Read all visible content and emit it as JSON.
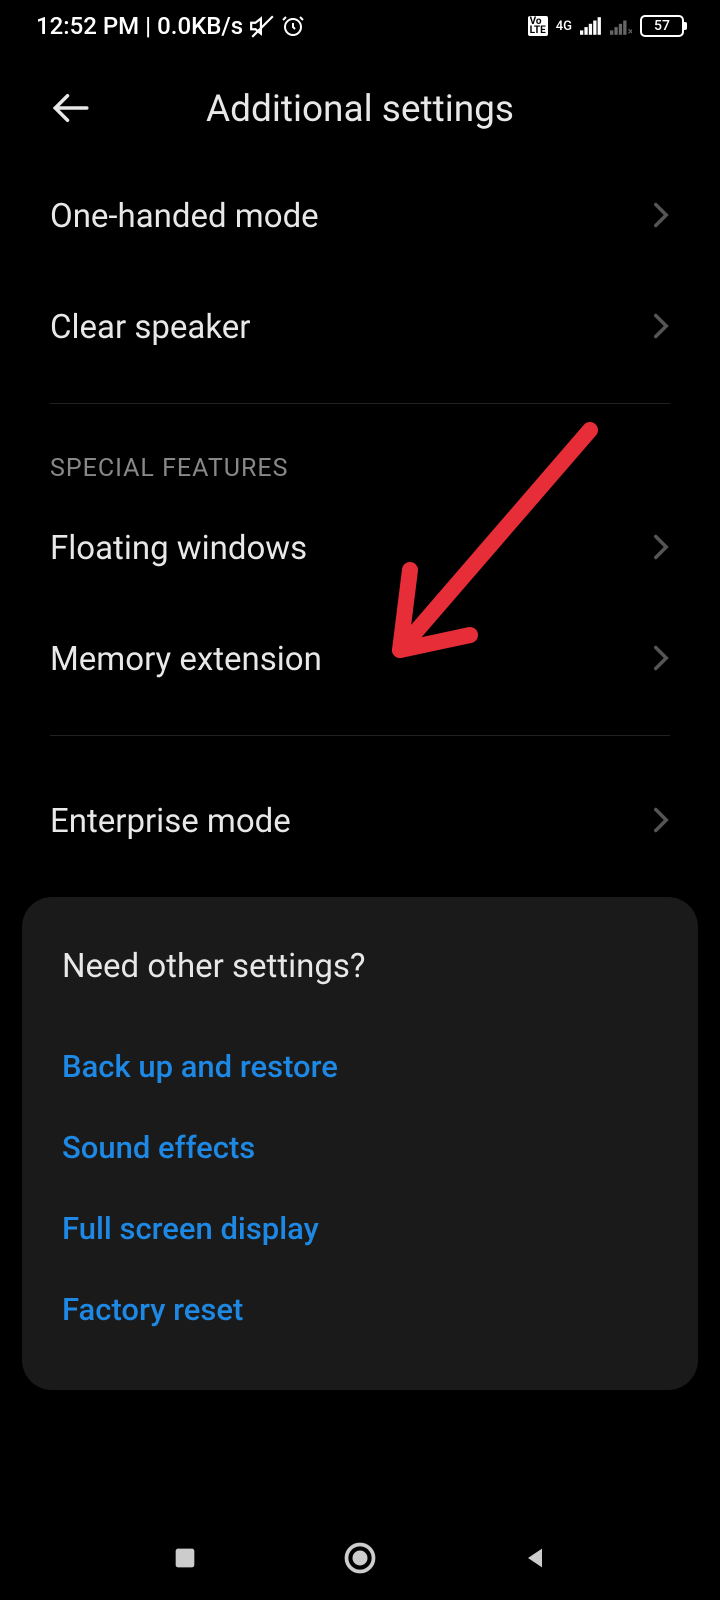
{
  "status_bar": {
    "time": "12:52 PM",
    "separator": "|",
    "network_speed": "0.0KB/s",
    "network_label": "4G",
    "battery_percent": "57"
  },
  "header": {
    "title": "Additional settings"
  },
  "settings": {
    "one_handed": "One-handed mode",
    "clear_speaker": "Clear speaker"
  },
  "special_section": {
    "header": "SPECIAL FEATURES",
    "floating_windows": "Floating windows",
    "memory_extension": "Memory extension"
  },
  "enterprise": {
    "label": "Enterprise mode"
  },
  "other_card": {
    "title": "Need other settings?",
    "links": {
      "backup": "Back up and restore",
      "sound": "Sound effects",
      "fullscreen": "Full screen display",
      "factory": "Factory reset"
    }
  }
}
